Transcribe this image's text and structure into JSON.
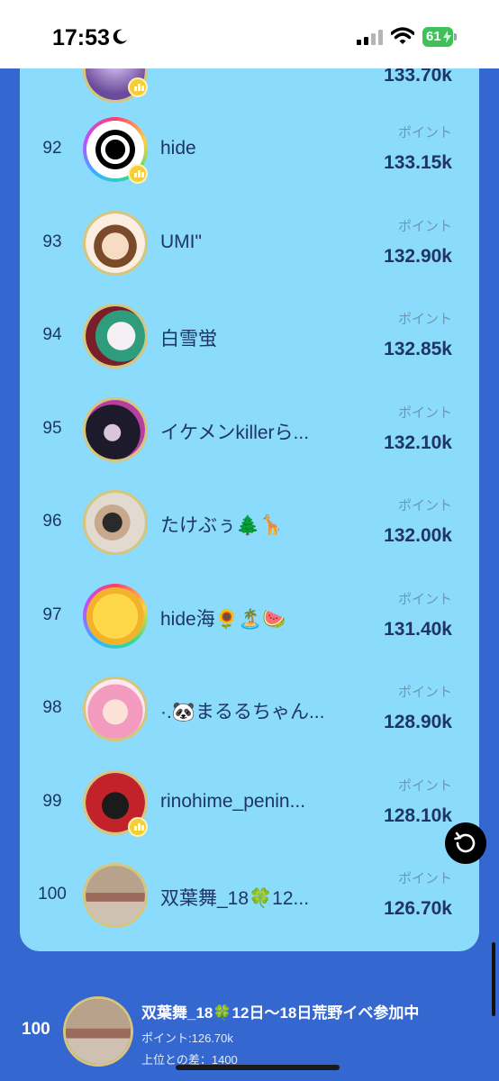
{
  "status": {
    "time": "17:53",
    "battery": "61"
  },
  "points_label": "ポイント",
  "top_partial": {
    "value": "133.70k"
  },
  "rows": [
    {
      "rank": "92",
      "name": "hide",
      "points": "133.15k"
    },
    {
      "rank": "93",
      "name": "UMI\"",
      "points": "132.90k"
    },
    {
      "rank": "94",
      "name": "白雪蛍",
      "points": "132.85k"
    },
    {
      "rank": "95",
      "name": "イケメンkillerら...",
      "points": "132.10k"
    },
    {
      "rank": "96",
      "name": "たけぶぅ🌲🦒",
      "points": "132.00k"
    },
    {
      "rank": "97",
      "name": "hide海🌻🏝️🍉",
      "points": "131.40k"
    },
    {
      "rank": "98",
      "name": "·.🐼まるるちゃん...",
      "points": "128.90k"
    },
    {
      "rank": "99",
      "name": "rinohime_penin...",
      "points": "128.10k"
    },
    {
      "rank": "100",
      "name": "双葉舞_18🍀12...",
      "points": "126.70k"
    }
  ],
  "me": {
    "rank": "100",
    "name": "双葉舞_18🍀12日〜18日荒野イベ参加中",
    "points_line": "ポイント:126.70k",
    "diff_line": "上位との差：1400"
  },
  "colors": {
    "card": "#8adbfc",
    "background": "#3567d0",
    "text": "#1f3468"
  }
}
